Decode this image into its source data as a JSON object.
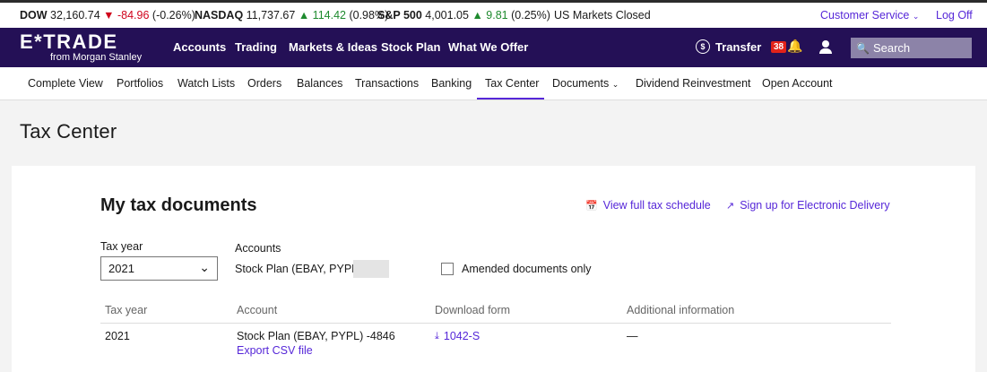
{
  "ticker": {
    "dow_label": "DOW",
    "dow_value": "32,160.74",
    "dow_change": "▼ -84.96",
    "dow_pct": "(-0.26%)",
    "nasdaq_label": "NASDAQ",
    "nasdaq_value": "11,737.67",
    "nasdaq_change": "▲ 114.42",
    "nasdaq_pct": "(0.98%)",
    "sp_label": "S&P 500",
    "sp_value": "4,001.05",
    "sp_change": "▲ 9.81",
    "sp_pct": "(0.25%)",
    "market_status": "US Markets Closed",
    "customer_service": "Customer Service",
    "logoff": "Log Off"
  },
  "brand": {
    "name": "E*TRADE",
    "sub": "from Morgan Stanley"
  },
  "mainnav": {
    "items": [
      "Accounts",
      "Trading",
      "Markets & Ideas",
      "Stock Plan",
      "What We Offer"
    ],
    "transfer": "Transfer",
    "notifications": "38",
    "search_placeholder": "Search"
  },
  "subnav": {
    "items": [
      "Complete View",
      "Portfolios",
      "Watch Lists",
      "Orders",
      "Balances",
      "Transactions",
      "Banking",
      "Tax Center",
      "Documents",
      "Dividend Reinvestment",
      "Open Account"
    ],
    "active": "Tax Center"
  },
  "page": {
    "title": "Tax Center"
  },
  "tax_docs": {
    "heading": "My tax documents",
    "view_schedule": "View full tax schedule",
    "signup_delivery": "Sign up for Electronic Delivery",
    "tax_year_label": "Tax year",
    "tax_year_value": "2021",
    "accounts_label": "Accounts",
    "account_value": "Stock Plan (EBAY, PYPL) -",
    "amended_label": "Amended documents only",
    "columns": [
      "Tax year",
      "Account",
      "Download form",
      "Additional information"
    ],
    "rows": [
      {
        "year": "2021",
        "account": "Stock Plan (EBAY, PYPL) -4846",
        "export": "Export CSV file",
        "form": "1042-S",
        "info": "—"
      }
    ]
  },
  "colors": {
    "brand_purple": "#241056",
    "link_purple": "#5627d8",
    "down_red": "#d0021b",
    "up_green": "#1e8a2e"
  }
}
